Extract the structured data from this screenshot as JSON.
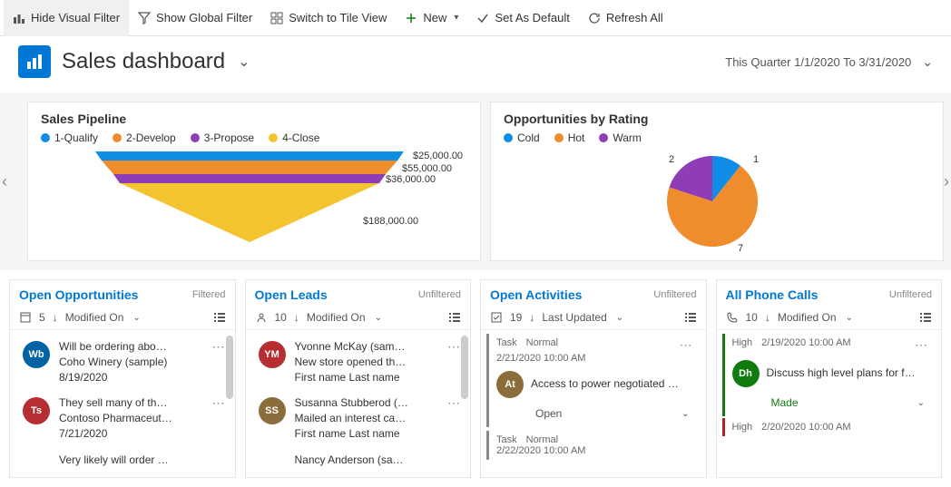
{
  "toolbar": {
    "hide_visual_filter": "Hide Visual Filter",
    "show_global_filter": "Show Global Filter",
    "switch_tile": "Switch to Tile View",
    "new": "New",
    "set_default": "Set As Default",
    "refresh_all": "Refresh All"
  },
  "header": {
    "title": "Sales dashboard",
    "date_range": "This Quarter 1/1/2020 To 3/31/2020"
  },
  "charts": {
    "pipeline": {
      "title": "Sales Pipeline",
      "legend": [
        "1-Qualify",
        "2-Develop",
        "3-Propose",
        "4-Close"
      ],
      "colors": [
        "#0f8ce6",
        "#ef8c2b",
        "#8f3db6",
        "#f4c430"
      ]
    },
    "rating": {
      "title": "Opportunities by Rating",
      "legend": [
        "Cold",
        "Hot",
        "Warm"
      ],
      "colors": [
        "#0f8ce6",
        "#ef8c2b",
        "#8f3db6"
      ]
    }
  },
  "chart_data": [
    {
      "type": "funnel",
      "title": "Sales Pipeline",
      "series": [
        {
          "name": "1-Qualify",
          "value": 25000,
          "label": "$25,000.00"
        },
        {
          "name": "2-Develop",
          "value": 55000,
          "label": "$55,000.00"
        },
        {
          "name": "3-Propose",
          "value": 36000,
          "label": "$36,000.00"
        },
        {
          "name": "4-Close",
          "value": 188000,
          "label": "$188,000.00"
        }
      ]
    },
    {
      "type": "pie",
      "title": "Opportunities by Rating",
      "series": [
        {
          "name": "Cold",
          "value": 1,
          "label": "1"
        },
        {
          "name": "Hot",
          "value": 7,
          "label": "7"
        },
        {
          "name": "Warm",
          "value": 2,
          "label": "2"
        }
      ]
    }
  ],
  "cards": {
    "opportunities": {
      "title": "Open Opportunities",
      "status": "Filtered",
      "count": "5",
      "sort": "Modified On",
      "items": [
        {
          "title": "Will be ordering abo…",
          "subtitle": "Coho Winery (sample)",
          "date": "8/19/2020",
          "initials": "Wb",
          "color": "#0062a3"
        },
        {
          "title": "They sell many of th…",
          "subtitle": "Contoso Pharmaceut…",
          "date": "7/21/2020",
          "initials": "Ts",
          "color": "#b52e31"
        },
        {
          "title": "Very likely will order …",
          "subtitle": "",
          "date": "",
          "initials": "",
          "color": ""
        }
      ]
    },
    "leads": {
      "title": "Open Leads",
      "status": "Unfiltered",
      "count": "10",
      "sort": "Modified On",
      "items": [
        {
          "title": "Yvonne McKay (sam…",
          "subtitle": "New store opened th…",
          "extra": "First name Last name",
          "initials": "YM",
          "color": "#b52e31"
        },
        {
          "title": "Susanna Stubberod (…",
          "subtitle": "Mailed an interest ca…",
          "extra": "First name Last name",
          "initials": "SS",
          "color": "#8a6d3b"
        },
        {
          "title": "Nancy Anderson (sa…",
          "subtitle": "",
          "extra": "",
          "initials": "",
          "color": ""
        }
      ]
    },
    "activities": {
      "title": "Open Activities",
      "status": "Unfiltered",
      "count": "19",
      "sort": "Last Updated",
      "items": [
        {
          "type": "Task",
          "priority": "Normal",
          "date": "2/21/2020 10:00 AM",
          "subject": "Access to power negotiated …",
          "initials": "At",
          "color": "#8a6d3b",
          "statusText": "Open"
        },
        {
          "type": "Task",
          "priority": "Normal",
          "date": "2/22/2020 10:00 AM"
        }
      ]
    },
    "phone": {
      "title": "All Phone Calls",
      "status": "Unfiltered",
      "count": "10",
      "sort": "Modified On",
      "items": [
        {
          "priority": "High",
          "date": "2/19/2020 10:00 AM",
          "subject": "Discuss high level plans for f…",
          "initials": "Dh",
          "color": "#107c10",
          "statusText": "Made"
        },
        {
          "priority": "High",
          "date": "2/20/2020 10:00 AM"
        }
      ]
    }
  }
}
